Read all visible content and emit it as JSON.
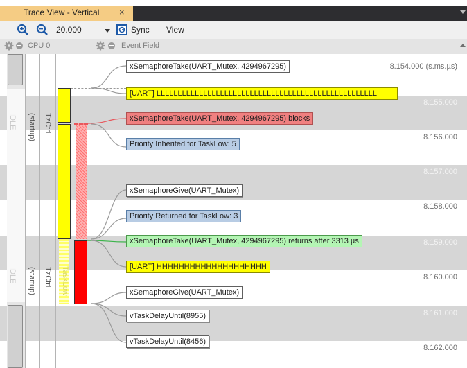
{
  "tab": {
    "title": "Trace View - Vertical",
    "close": "×"
  },
  "toolbar": {
    "zoom_value": "20.000",
    "sync_label": "Sync",
    "view_label": "View"
  },
  "columns": {
    "cpu": "CPU 0",
    "event_field": "Event Field"
  },
  "time_labels": [
    "8.154.000 (s.ms.µs)",
    "8.155.000",
    "8.156.000",
    "8.157.000",
    "8.158.000",
    "8.159.000",
    "8.160.000",
    "8.161.000",
    "8.162.000"
  ],
  "lanes": {
    "group1": {
      "idle": "IDLE",
      "startup": "(startup)",
      "tzctrl": "TzCtrl"
    },
    "group2": {
      "idle": "IDLE",
      "startup": "(startup)",
      "tzctrl": "TzCtrl",
      "tasklow": "TaskLow"
    }
  },
  "events": [
    {
      "text": "xSemaphoreTake(UART_Mutex, 4294967295)",
      "style": "white"
    },
    {
      "text": "[UART] LLLLLLLLLLLLLLLLLLLLLLLLLLLLLLLLLLLLLLLLLLLLLLLLLLLL",
      "style": "yellow"
    },
    {
      "text": "xSemaphoreTake(UART_Mutex, 4294967295) blocks",
      "style": "red"
    },
    {
      "text": "Priority Inherited for TaskLow: 5",
      "style": "blue"
    },
    {
      "text": "xSemaphoreGive(UART_Mutex)",
      "style": "white"
    },
    {
      "text": "Priority Returned for TaskLow: 3",
      "style": "blue"
    },
    {
      "text": "xSemaphoreTake(UART_Mutex, 4294967295) returns after 3313 µs",
      "style": "green"
    },
    {
      "text": "[UART]  HHHHHHHHHHHHHHHHHHHH",
      "style": "yellow"
    },
    {
      "text": "xSemaphoreGive(UART_Mutex)",
      "style": "white"
    },
    {
      "text": "vTaskDelayUntil(8955)",
      "style": "white"
    },
    {
      "text": "vTaskDelayUntil(8456)",
      "style": "white"
    }
  ],
  "colors": {
    "tab_active": "#f5cc84",
    "band_gray": "#d6d6d6",
    "task_yellow": "#ffff00",
    "task_red": "#ff0000",
    "connector_red": "#e8575c",
    "connector_green": "#3cb44b",
    "toolbar_blue": "#1e5aa8"
  },
  "icons": [
    "zoom-in-icon",
    "zoom-out-icon",
    "dropdown-arrow-icon",
    "sync-icon",
    "gear-icon",
    "collapse-icon",
    "close-icon",
    "scroll-up-icon"
  ]
}
